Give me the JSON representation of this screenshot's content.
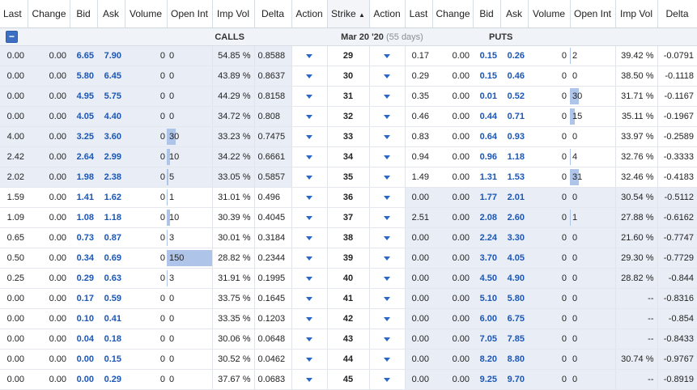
{
  "header": {
    "calls_cols": [
      "Last",
      "Change",
      "Bid",
      "Ask",
      "Volume",
      "Open Int",
      "Imp Vol",
      "Delta",
      "Action"
    ],
    "strike_col": "Strike",
    "sort_glyph": "▲",
    "puts_cols": [
      "Action",
      "Last",
      "Change",
      "Bid",
      "Ask",
      "Volume",
      "Open Int",
      "Imp Vol",
      "Delta"
    ]
  },
  "section": {
    "collapse_glyph": "−",
    "calls_label": "CALLS",
    "expiry_label": "Mar 20 '20",
    "days_label": "(55 days)",
    "puts_label": "PUTS"
  },
  "colors": {
    "itm_bg": "#e9eef6",
    "oi_bar": "#aec4e9",
    "price_blue": "#1b56b5",
    "action_blue": "#2a67c9"
  },
  "icons": {
    "action": "caret-down-icon",
    "collapse": "minus-icon"
  },
  "oi_scale_max": 150,
  "rows": [
    {
      "strike": "29",
      "call_itm": true,
      "c_last": "0.00",
      "c_change": "0.00",
      "c_bid": "6.65",
      "c_ask": "7.90",
      "c_volume": "0",
      "c_oi": "0",
      "c_iv": "54.85 %",
      "c_delta": "0.8588",
      "put_itm": false,
      "p_last": "0.17",
      "p_change": "0.00",
      "p_bid": "0.15",
      "p_ask": "0.26",
      "p_volume": "0",
      "p_oi": "2",
      "p_iv": "39.42 %",
      "p_delta": "-0.0791"
    },
    {
      "strike": "30",
      "call_itm": true,
      "c_last": "0.00",
      "c_change": "0.00",
      "c_bid": "5.80",
      "c_ask": "6.45",
      "c_volume": "0",
      "c_oi": "0",
      "c_iv": "43.89 %",
      "c_delta": "0.8637",
      "put_itm": false,
      "p_last": "0.29",
      "p_change": "0.00",
      "p_bid": "0.15",
      "p_ask": "0.46",
      "p_volume": "0",
      "p_oi": "0",
      "p_iv": "38.50 %",
      "p_delta": "-0.1118"
    },
    {
      "strike": "31",
      "call_itm": true,
      "c_last": "0.00",
      "c_change": "0.00",
      "c_bid": "4.95",
      "c_ask": "5.75",
      "c_volume": "0",
      "c_oi": "0",
      "c_iv": "44.29 %",
      "c_delta": "0.8158",
      "put_itm": false,
      "p_last": "0.35",
      "p_change": "0.00",
      "p_bid": "0.01",
      "p_ask": "0.52",
      "p_volume": "0",
      "p_oi": "30",
      "p_iv": "31.71 %",
      "p_delta": "-0.1167"
    },
    {
      "strike": "32",
      "call_itm": true,
      "c_last": "0.00",
      "c_change": "0.00",
      "c_bid": "4.05",
      "c_ask": "4.40",
      "c_volume": "0",
      "c_oi": "0",
      "c_iv": "34.72 %",
      "c_delta": "0.808",
      "put_itm": false,
      "p_last": "0.46",
      "p_change": "0.00",
      "p_bid": "0.44",
      "p_ask": "0.71",
      "p_volume": "0",
      "p_oi": "15",
      "p_iv": "35.11 %",
      "p_delta": "-0.1967"
    },
    {
      "strike": "33",
      "call_itm": true,
      "c_last": "4.00",
      "c_change": "0.00",
      "c_bid": "3.25",
      "c_ask": "3.60",
      "c_volume": "0",
      "c_oi": "30",
      "c_iv": "33.23 %",
      "c_delta": "0.7475",
      "put_itm": false,
      "p_last": "0.83",
      "p_change": "0.00",
      "p_bid": "0.64",
      "p_ask": "0.93",
      "p_volume": "0",
      "p_oi": "0",
      "p_iv": "33.97 %",
      "p_delta": "-0.2589"
    },
    {
      "strike": "34",
      "call_itm": true,
      "c_last": "2.42",
      "c_change": "0.00",
      "c_bid": "2.64",
      "c_ask": "2.99",
      "c_volume": "0",
      "c_oi": "10",
      "c_iv": "34.22 %",
      "c_delta": "0.6661",
      "put_itm": false,
      "p_last": "0.94",
      "p_change": "0.00",
      "p_bid": "0.96",
      "p_ask": "1.18",
      "p_volume": "0",
      "p_oi": "4",
      "p_iv": "32.76 %",
      "p_delta": "-0.3333"
    },
    {
      "strike": "35",
      "call_itm": true,
      "c_last": "2.02",
      "c_change": "0.00",
      "c_bid": "1.98",
      "c_ask": "2.38",
      "c_volume": "0",
      "c_oi": "5",
      "c_iv": "33.05 %",
      "c_delta": "0.5857",
      "put_itm": false,
      "p_last": "1.49",
      "p_change": "0.00",
      "p_bid": "1.31",
      "p_ask": "1.53",
      "p_volume": "0",
      "p_oi": "31",
      "p_iv": "32.46 %",
      "p_delta": "-0.4183"
    },
    {
      "strike": "36",
      "call_itm": false,
      "c_last": "1.59",
      "c_change": "0.00",
      "c_bid": "1.41",
      "c_ask": "1.62",
      "c_volume": "0",
      "c_oi": "1",
      "c_iv": "31.01 %",
      "c_delta": "0.496",
      "put_itm": true,
      "p_last": "0.00",
      "p_change": "0.00",
      "p_bid": "1.77",
      "p_ask": "2.01",
      "p_volume": "0",
      "p_oi": "0",
      "p_iv": "30.54 %",
      "p_delta": "-0.5112"
    },
    {
      "strike": "37",
      "call_itm": false,
      "c_last": "1.09",
      "c_change": "0.00",
      "c_bid": "1.08",
      "c_ask": "1.18",
      "c_volume": "0",
      "c_oi": "10",
      "c_iv": "30.39 %",
      "c_delta": "0.4045",
      "put_itm": true,
      "p_last": "2.51",
      "p_change": "0.00",
      "p_bid": "2.08",
      "p_ask": "2.60",
      "p_volume": "0",
      "p_oi": "1",
      "p_iv": "27.88 %",
      "p_delta": "-0.6162"
    },
    {
      "strike": "38",
      "call_itm": false,
      "c_last": "0.65",
      "c_change": "0.00",
      "c_bid": "0.73",
      "c_ask": "0.87",
      "c_volume": "0",
      "c_oi": "3",
      "c_iv": "30.01 %",
      "c_delta": "0.3184",
      "put_itm": true,
      "p_last": "0.00",
      "p_change": "0.00",
      "p_bid": "2.24",
      "p_ask": "3.30",
      "p_volume": "0",
      "p_oi": "0",
      "p_iv": "21.60 %",
      "p_delta": "-0.7747"
    },
    {
      "strike": "39",
      "call_itm": false,
      "c_last": "0.50",
      "c_change": "0.00",
      "c_bid": "0.34",
      "c_ask": "0.69",
      "c_volume": "0",
      "c_oi": "150",
      "c_iv": "28.82 %",
      "c_delta": "0.2344",
      "put_itm": true,
      "p_last": "0.00",
      "p_change": "0.00",
      "p_bid": "3.70",
      "p_ask": "4.05",
      "p_volume": "0",
      "p_oi": "0",
      "p_iv": "29.30 %",
      "p_delta": "-0.7729"
    },
    {
      "strike": "40",
      "call_itm": false,
      "c_last": "0.25",
      "c_change": "0.00",
      "c_bid": "0.29",
      "c_ask": "0.63",
      "c_volume": "0",
      "c_oi": "3",
      "c_iv": "31.91 %",
      "c_delta": "0.1995",
      "put_itm": true,
      "p_last": "0.00",
      "p_change": "0.00",
      "p_bid": "4.50",
      "p_ask": "4.90",
      "p_volume": "0",
      "p_oi": "0",
      "p_iv": "28.82 %",
      "p_delta": "-0.844"
    },
    {
      "strike": "41",
      "call_itm": false,
      "c_last": "0.00",
      "c_change": "0.00",
      "c_bid": "0.17",
      "c_ask": "0.59",
      "c_volume": "0",
      "c_oi": "0",
      "c_iv": "33.75 %",
      "c_delta": "0.1645",
      "put_itm": true,
      "p_last": "0.00",
      "p_change": "0.00",
      "p_bid": "5.10",
      "p_ask": "5.80",
      "p_volume": "0",
      "p_oi": "0",
      "p_iv": "--",
      "p_delta": "-0.8316"
    },
    {
      "strike": "42",
      "call_itm": false,
      "c_last": "0.00",
      "c_change": "0.00",
      "c_bid": "0.10",
      "c_ask": "0.41",
      "c_volume": "0",
      "c_oi": "0",
      "c_iv": "33.35 %",
      "c_delta": "0.1203",
      "put_itm": true,
      "p_last": "0.00",
      "p_change": "0.00",
      "p_bid": "6.00",
      "p_ask": "6.75",
      "p_volume": "0",
      "p_oi": "0",
      "p_iv": "--",
      "p_delta": "-0.854"
    },
    {
      "strike": "43",
      "call_itm": false,
      "c_last": "0.00",
      "c_change": "0.00",
      "c_bid": "0.04",
      "c_ask": "0.18",
      "c_volume": "0",
      "c_oi": "0",
      "c_iv": "30.06 %",
      "c_delta": "0.0648",
      "put_itm": true,
      "p_last": "0.00",
      "p_change": "0.00",
      "p_bid": "7.05",
      "p_ask": "7.85",
      "p_volume": "0",
      "p_oi": "0",
      "p_iv": "--",
      "p_delta": "-0.8433"
    },
    {
      "strike": "44",
      "call_itm": false,
      "c_last": "0.00",
      "c_change": "0.00",
      "c_bid": "0.00",
      "c_ask": "0.15",
      "c_volume": "0",
      "c_oi": "0",
      "c_iv": "30.52 %",
      "c_delta": "0.0462",
      "put_itm": true,
      "p_last": "0.00",
      "p_change": "0.00",
      "p_bid": "8.20",
      "p_ask": "8.80",
      "p_volume": "0",
      "p_oi": "0",
      "p_iv": "30.74 %",
      "p_delta": "-0.9767"
    },
    {
      "strike": "45",
      "call_itm": false,
      "c_last": "0.00",
      "c_change": "0.00",
      "c_bid": "0.00",
      "c_ask": "0.29",
      "c_volume": "0",
      "c_oi": "0",
      "c_iv": "37.67 %",
      "c_delta": "0.0683",
      "put_itm": true,
      "p_last": "0.00",
      "p_change": "0.00",
      "p_bid": "9.25",
      "p_ask": "9.70",
      "p_volume": "0",
      "p_oi": "0",
      "p_iv": "--",
      "p_delta": "-0.8919"
    }
  ]
}
